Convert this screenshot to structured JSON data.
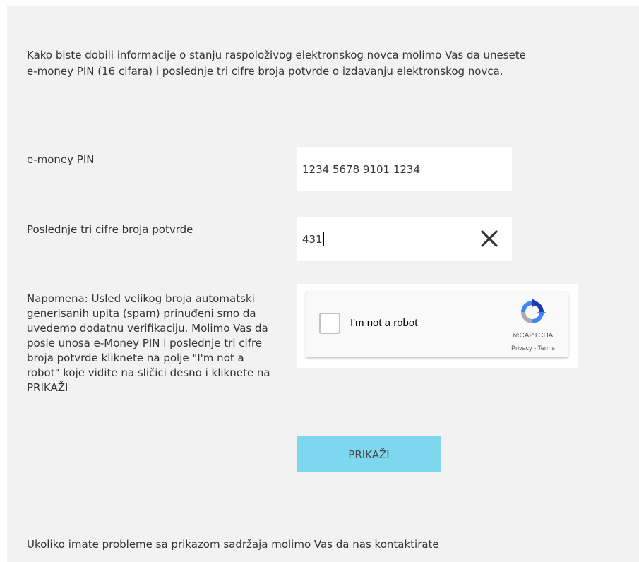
{
  "intro": {
    "line1": "Kako biste dobili informacije o stanju raspoloživog elektronskog novca molimo Vas da unesete",
    "line2": "e-money PIN (16 cifara) i poslednje tri cifre broja potvrde o izdavanju elektronskog novca."
  },
  "form": {
    "pin_label": "e-money PIN",
    "pin_value": "1234 5678 9101 1234",
    "cifre_label": "Poslednje tri cifre broja potvrde",
    "cifre_value": "431",
    "clear_icon": "close-x-icon"
  },
  "note": {
    "lines": [
      "Napomena: Usled velikog broja automatski",
      "generisanih upita (spam) prinuđeni smo da",
      "uvedemo dodatnu verifikaciju. Molimo Vas da",
      "posle unosa e-Money PIN i poslednje tri cifre",
      "broja potvrde kliknete na polje \"I'm not a",
      "robot\" koje vidite na sličici desno i kliknete na",
      "PRIKAŽI"
    ]
  },
  "captcha": {
    "label": "I'm not a robot",
    "brand": "reCAPTCHA",
    "privacy": "Privacy",
    "separator": " - ",
    "terms": "Terms",
    "logo_icon": "recaptcha-logo-icon"
  },
  "submit": {
    "label": "PRIKAŽI",
    "color": "#7dd8ef"
  },
  "footer": {
    "text": "Ukoliko imate probleme sa prikazom sadržaja molimo Vas da nas ",
    "link": "kontaktirate"
  },
  "colors": {
    "panel_bg": "#f2f2f2",
    "button_bg": "#7dd8ef"
  }
}
